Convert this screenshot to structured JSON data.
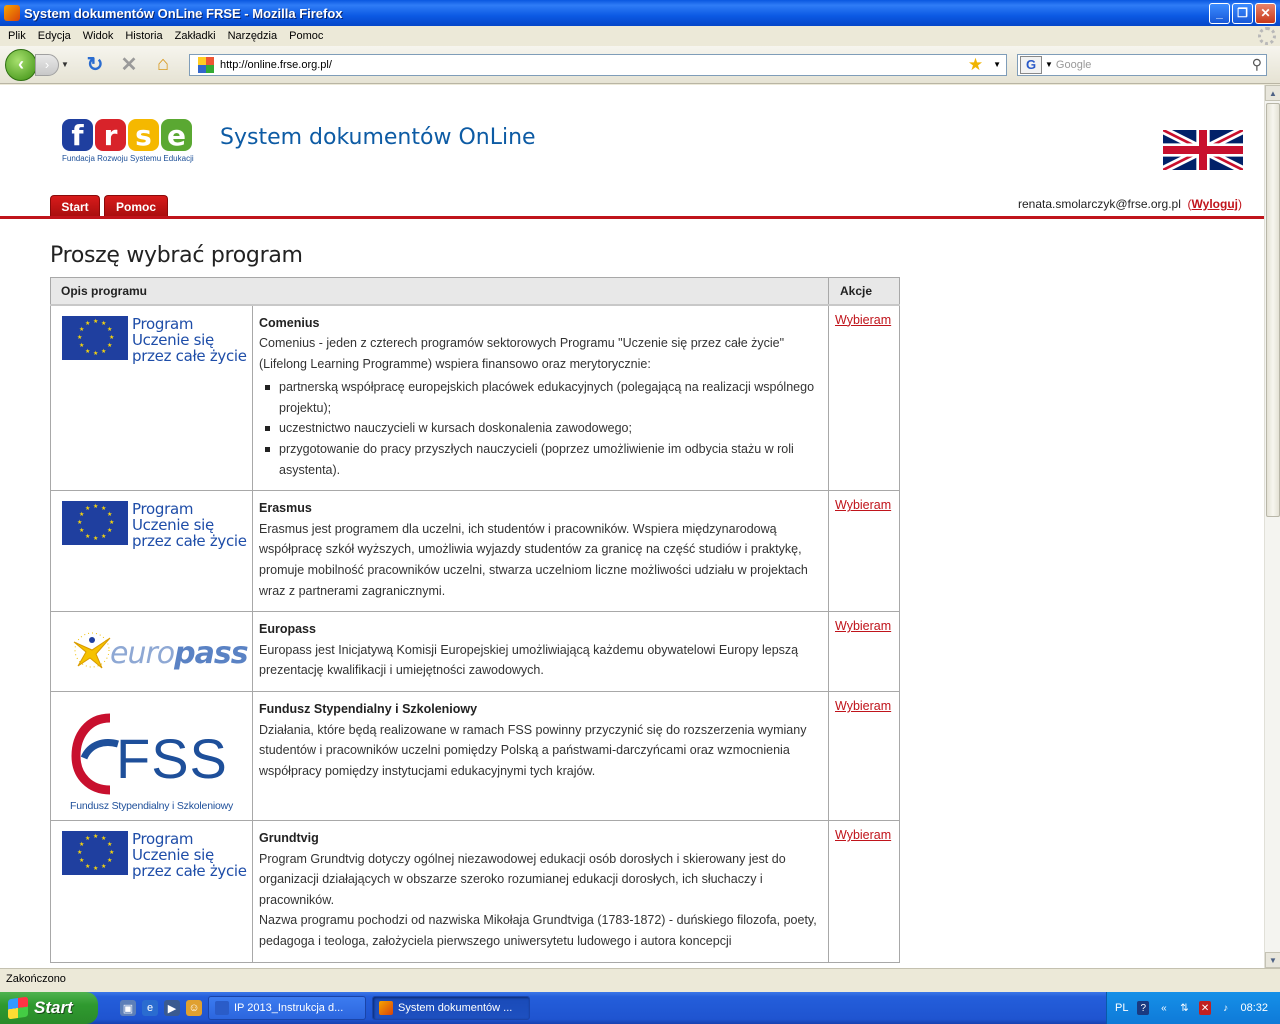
{
  "window": {
    "title": "System dokumentów OnLine FRSE - Mozilla Firefox",
    "min_icon": "minimize-icon",
    "max_icon": "maximize-icon",
    "close_icon": "close-icon"
  },
  "menu": {
    "items": [
      "Plik",
      "Edycja",
      "Widok",
      "Historia",
      "Zakładki",
      "Narzędzia",
      "Pomoc"
    ]
  },
  "nav": {
    "url": "http://online.frse.org.pl/",
    "search_placeholder": "Google",
    "search_engine_letter": "G"
  },
  "header": {
    "logo_letters": [
      "f",
      "r",
      "s",
      "e"
    ],
    "logo_colors": [
      "#1f3f9f",
      "#d8232a",
      "#f5b800",
      "#5aa832"
    ],
    "logo_tagline": "Fundacja Rozwoju Systemu Edukacji",
    "system_title": "System dokumentów OnLine",
    "tabs": [
      "Start",
      "Pomoc"
    ],
    "user_email": "renata.smolarczyk@frse.org.pl",
    "logout_open": "(",
    "logout_label": "Wyloguj",
    "logout_close": ")"
  },
  "page": {
    "heading": "Proszę wybrać program",
    "table_headers": [
      "Opis programu",
      "Akcje"
    ],
    "action_label": "Wybieram",
    "llp_logo_text": [
      "Program",
      "Uczenie się",
      "przez całe życie"
    ],
    "europass_logo": {
      "eu": "euro",
      "pass": "pass"
    },
    "fss_logo": {
      "letters": "FSS",
      "subtitle": "Fundusz Stypendialny i Szkoleniowy"
    },
    "programs": [
      {
        "name": "Comenius",
        "logo": "llp",
        "paragraphs": [
          "Comenius - jeden z czterech programów sektorowych Programu \"Uczenie się przez całe życie\" (Lifelong Learning Programme) wspiera finansowo oraz merytorycznie:"
        ],
        "bullets": [
          "partnerską współpracę europejskich placówek edukacyjnych (polegającą na realizacji wspólnego projektu);",
          "uczestnictwo nauczycieli w kursach doskonalenia zawodowego;",
          "przygotowanie do pracy przyszłych nauczycieli (poprzez umożliwienie im odbycia stażu w roli asystenta)."
        ]
      },
      {
        "name": "Erasmus",
        "logo": "llp",
        "paragraphs": [
          "Erasmus jest programem dla uczelni, ich studentów i pracowników. Wspiera międzynarodową współpracę szkół wyższych, umożliwia wyjazdy studentów za granicę na część studiów i praktykę, promuje mobilność pracowników uczelni, stwarza uczelniom liczne możliwości udziału w projektach wraz z partnerami zagranicznymi."
        ],
        "bullets": []
      },
      {
        "name": "Europass",
        "logo": "europass",
        "paragraphs": [
          "Europass jest Inicjatywą Komisji Europejskiej umożliwiającą każdemu obywatelowi Europy lepszą prezentację kwalifikacji i umiejętności zawodowych."
        ],
        "bullets": []
      },
      {
        "name": "Fundusz Stypendialny i Szkoleniowy",
        "logo": "fss",
        "paragraphs": [
          "Działania, które będą realizowane w ramach FSS powinny przyczynić się do rozszerzenia wymiany studentów i pracowników uczelni pomiędzy Polską a państwami-darczyńcami oraz wzmocnienia współpracy pomiędzy instytucjami edukacyjnymi tych krajów."
        ],
        "bullets": []
      },
      {
        "name": "Grundtvig",
        "logo": "llp",
        "paragraphs": [
          "Program Grundtvig dotyczy ogólnej niezawodowej edukacji osób dorosłych i skierowany jest do organizacji działających w obszarze szeroko rozumianej edukacji dorosłych, ich słuchaczy i pracowników.",
          "Nazwa programu pochodzi od nazwiska Mikołaja Grundtviga (1783-1872) - duńskiego filozofa, poety, pedagoga i teologa, założyciela pierwszego uniwersytetu ludowego i autora koncepcji"
        ],
        "bullets": []
      }
    ]
  },
  "status": {
    "text": "Zakończono"
  },
  "taskbar": {
    "start_label": "Start",
    "items": [
      "IP 2013_Instrukcja d...",
      "System dokumentów ..."
    ],
    "language": "PL",
    "clock": "08:32"
  }
}
